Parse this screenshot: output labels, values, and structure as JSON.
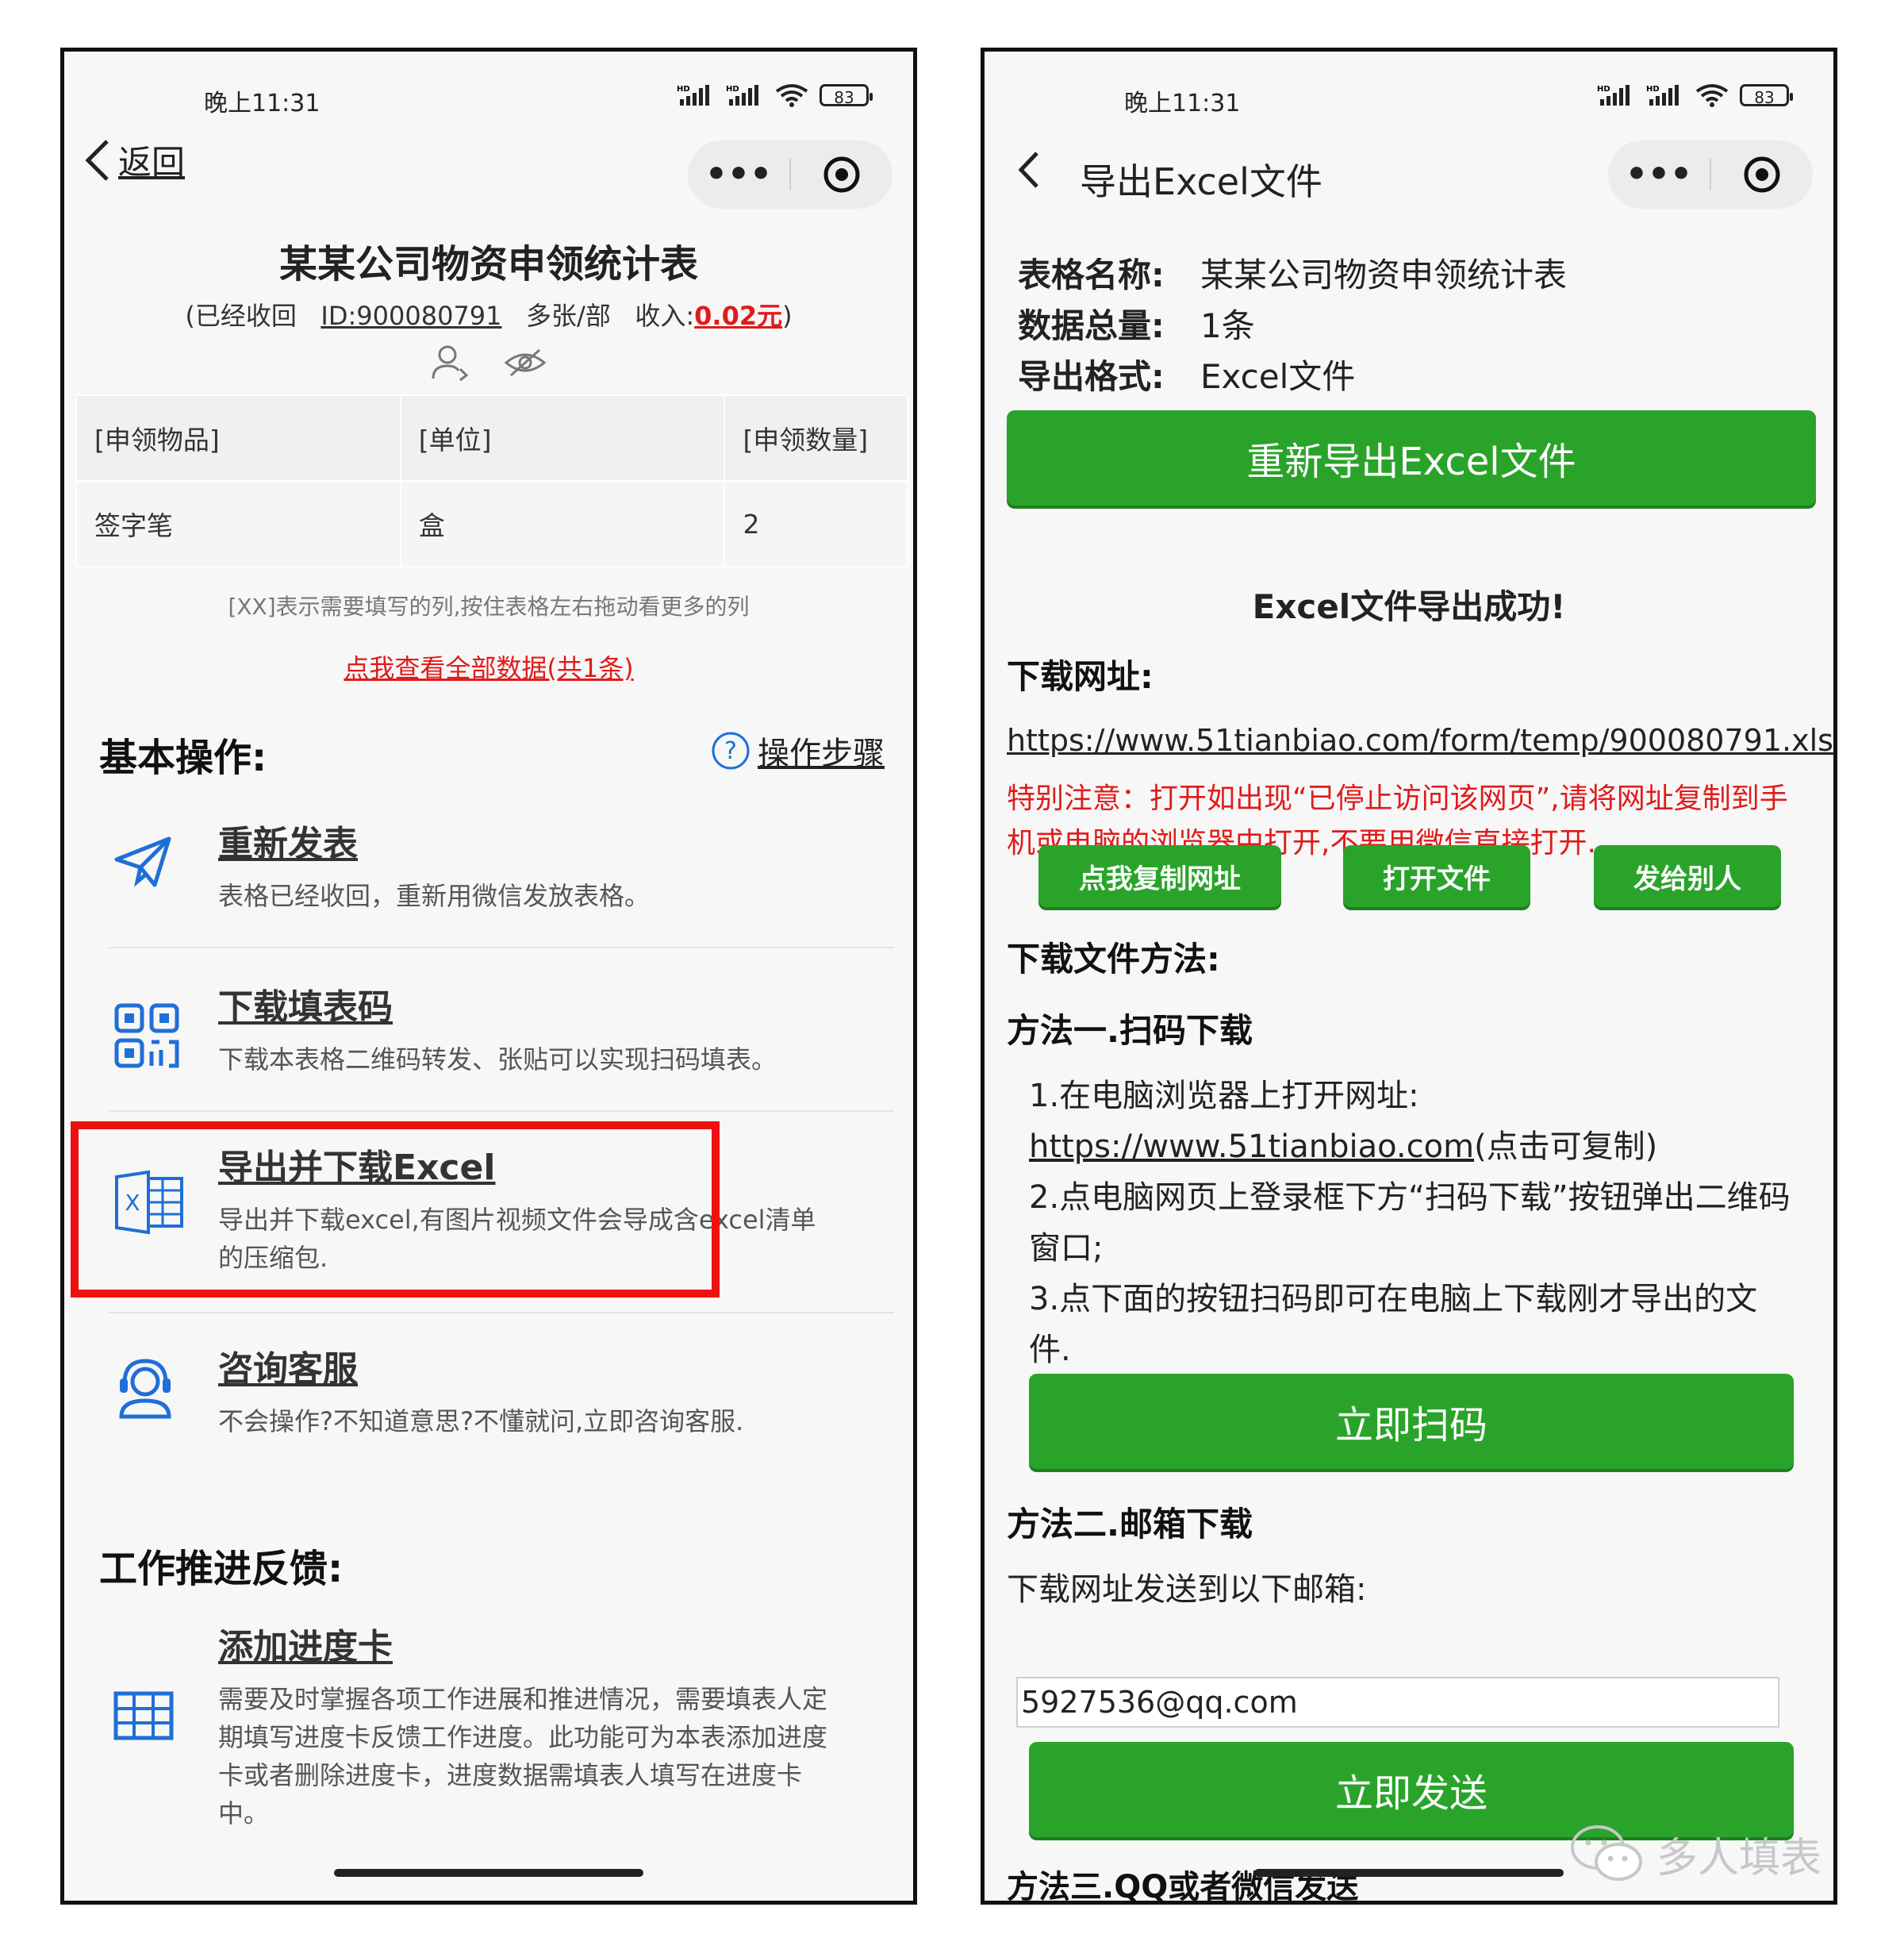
{
  "status": {
    "time": "晚上11:31",
    "signal_label": "HD",
    "battery": "83"
  },
  "left": {
    "back_label": "返回",
    "form_title": "某某公司物资申领统计表",
    "meta": {
      "open_paren": "(",
      "state": "已经收回",
      "id": "ID:900080791",
      "mode": "多张/部",
      "income_label": "收入:",
      "income": "0.02元",
      "close_paren": ")"
    },
    "table": {
      "headers": [
        "[申领物品]",
        "[单位]",
        "[申领数量]"
      ],
      "rows": [
        [
          "签字笔",
          "盒",
          "2"
        ]
      ]
    },
    "hint": "[XX]表示需要填写的列,按住表格左右拖动看更多的列",
    "view_all": "点我查看全部数据(共1条)",
    "basic_ops_title": "基本操作:",
    "steps_label": "操作步骤",
    "ops": [
      {
        "title": "重新发表",
        "desc": "表格已经收回，重新用微信发放表格。"
      },
      {
        "title": "下载填表码",
        "desc": "下载本表格二维码转发、张贴可以实现扫码填表。"
      },
      {
        "title": "导出并下载Excel",
        "desc": "导出并下载excel,有图片视频文件会导成含excel清单的压缩包."
      },
      {
        "title": "咨询客服",
        "desc": "不会操作?不知道意思?不懂就问,立即咨询客服."
      }
    ],
    "feedback_title": "工作推进反馈:",
    "progress": {
      "title": "添加进度卡",
      "desc": "需要及时掌握各项工作进展和推进情况，需要填表人定期填写进度卡反馈工作进度。此功能可为本表添加进度卡或者删除进度卡，进度数据需填表人填写在进度卡中。"
    }
  },
  "right": {
    "page_title": "导出Excel文件",
    "info": [
      {
        "k": "表格名称:",
        "v": "某某公司物资申领统计表"
      },
      {
        "k": "数据总量:",
        "v": "1条"
      },
      {
        "k": "导出格式:",
        "v": "Excel文件"
      }
    ],
    "reexport_button": "重新导出Excel文件",
    "success": "Excel文件导出成功!",
    "download_url_label": "下载网址:",
    "download_url": "https://www.51tianbiao.com/form/temp/900080791.xls",
    "notice": "特别注意：打开如出现“已停止访问该网页”,请将网址复制到手机或电脑的浏览器中打开,不要用微信直接打开.",
    "buttons": {
      "copy": "点我复制网址",
      "open": "打开文件",
      "send": "发给别人"
    },
    "methods_title": "下载文件方法:",
    "method1_title": "方法一.扫码下载",
    "method1": {
      "step1": "1.在电脑浏览器上打开网址:",
      "site": "https://www.51tianbiao.com",
      "site_suffix": "(点击可复制)",
      "step2": "2.点电脑网页上登录框下方“扫码下载”按钮弹出二维码窗口;",
      "step3": "3.点下面的按钮扫码即可在电脑上下载刚才导出的文件."
    },
    "scan_button": "立即扫码",
    "method2_title": "方法二.邮箱下载",
    "email_label": "下载网址发送到以下邮箱:",
    "email": "5927536@qq.com",
    "send_button": "立即发送",
    "method3_cut": "方法三.QQ或者微信发送"
  },
  "watermark": "多人填表",
  "colors": {
    "green": "#2aa32a",
    "red": "#e01b1b",
    "icon_blue": "#1f6fd6"
  }
}
